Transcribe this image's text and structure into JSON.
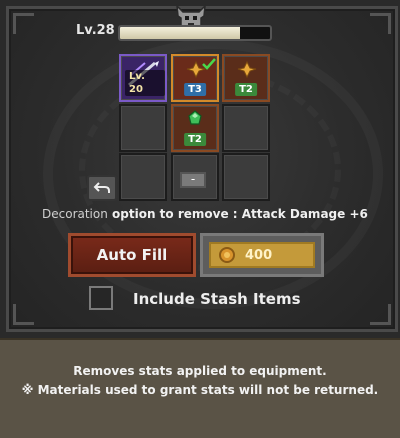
{
  "header": {
    "level_label": "Lv.28",
    "xp_fraction": 0.8
  },
  "slots": {
    "weapon": {
      "level_tag": "Lv. 20"
    },
    "selected": {
      "tier_tag": "T3"
    },
    "slot3": {
      "tier_tag": "T2"
    },
    "gem": {
      "tier_tag": "T2"
    },
    "minus_label": "-"
  },
  "back_icon": "undo-arrow",
  "info": {
    "prefix": "Decoration",
    "text": " option to remove : Attack Damage +6"
  },
  "buttons": {
    "auto_fill": "Auto Fill",
    "cost": "400"
  },
  "include_stash": {
    "label": "Include Stash Items",
    "checked": false
  },
  "footer": {
    "line1": "Removes stats applied to equipment.",
    "line2": "※ Materials used to grant stats will not be returned."
  },
  "colors": {
    "accent_red": "#7a2a1a",
    "gold": "#c49a3a",
    "tier_blue": "#2f6ea8",
    "tier_green": "#3b8a3b"
  }
}
